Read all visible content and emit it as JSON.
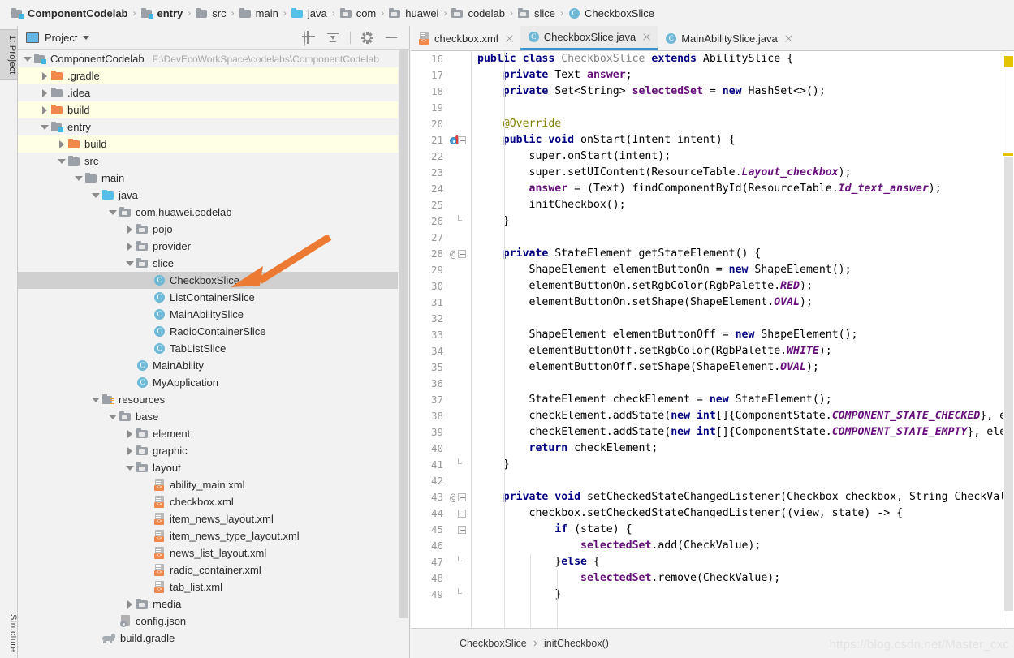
{
  "breadcrumb": {
    "items": [
      {
        "label": "ComponentCodelab",
        "icon": "module-icon",
        "bold": true
      },
      {
        "label": "entry",
        "icon": "module-icon",
        "bold": true
      },
      {
        "label": "src",
        "icon": "folder-icon",
        "bold": false
      },
      {
        "label": "main",
        "icon": "folder-icon",
        "bold": false
      },
      {
        "label": "java",
        "icon": "folder-blue-icon",
        "bold": false
      },
      {
        "label": "com",
        "icon": "package-icon",
        "bold": false
      },
      {
        "label": "huawei",
        "icon": "package-icon",
        "bold": false
      },
      {
        "label": "codelab",
        "icon": "package-icon",
        "bold": false
      },
      {
        "label": "slice",
        "icon": "package-icon",
        "bold": false
      },
      {
        "label": "CheckboxSlice",
        "icon": "class-icon",
        "bold": false
      }
    ],
    "separator": "›"
  },
  "left_strip": {
    "project_tab": "1: Project",
    "structure_tab": "Structure"
  },
  "project_panel": {
    "title": "Project",
    "dropdown_icon": "chevron-down-icon",
    "actions": [
      {
        "name": "locate-icon",
        "tooltip": "Select Opened File"
      },
      {
        "name": "collapse-all-icon",
        "tooltip": "Collapse All"
      },
      {
        "name": "gear-icon",
        "tooltip": "Settings"
      },
      {
        "name": "minimize-icon",
        "tooltip": "Hide"
      }
    ],
    "tree": [
      {
        "label": "ComponentCodelab",
        "path": "F:\\DevEcoWorkSpace\\codelabs\\ComponentCodelab",
        "depth": 0,
        "twist": "open",
        "icon": "module-icon",
        "style": "normal"
      },
      {
        "label": ".gradle",
        "depth": 1,
        "twist": "closed",
        "icon": "folder-orange-icon",
        "style": "ignored"
      },
      {
        "label": ".idea",
        "depth": 1,
        "twist": "closed",
        "icon": "folder-icon",
        "style": "alt"
      },
      {
        "label": "build",
        "depth": 1,
        "twist": "closed",
        "icon": "folder-orange-icon",
        "style": "ignored"
      },
      {
        "label": "entry",
        "depth": 1,
        "twist": "open",
        "icon": "module-icon",
        "style": "alt"
      },
      {
        "label": "build",
        "depth": 2,
        "twist": "closed",
        "icon": "folder-orange-icon",
        "style": "ignored"
      },
      {
        "label": "src",
        "depth": 2,
        "twist": "open",
        "icon": "folder-icon",
        "style": "alt"
      },
      {
        "label": "main",
        "depth": 3,
        "twist": "open",
        "icon": "folder-icon",
        "style": "normal"
      },
      {
        "label": "java",
        "depth": 4,
        "twist": "open",
        "icon": "folder-blue-icon",
        "style": "alt"
      },
      {
        "label": "com.huawei.codelab",
        "depth": 5,
        "twist": "open",
        "icon": "package-icon",
        "style": "normal"
      },
      {
        "label": "pojo",
        "depth": 6,
        "twist": "closed",
        "icon": "package-icon",
        "style": "alt"
      },
      {
        "label": "provider",
        "depth": 6,
        "twist": "closed",
        "icon": "package-icon",
        "style": "normal"
      },
      {
        "label": "slice",
        "depth": 6,
        "twist": "open",
        "icon": "package-icon",
        "style": "alt"
      },
      {
        "label": "CheckboxSlice",
        "depth": 7,
        "twist": "none",
        "icon": "class-icon",
        "style": "selected"
      },
      {
        "label": "ListContainerSlice",
        "depth": 7,
        "twist": "none",
        "icon": "class-icon",
        "style": "alt"
      },
      {
        "label": "MainAbilitySlice",
        "depth": 7,
        "twist": "none",
        "icon": "class-icon",
        "style": "normal"
      },
      {
        "label": "RadioContainerSlice",
        "depth": 7,
        "twist": "none",
        "icon": "class-icon",
        "style": "alt"
      },
      {
        "label": "TabListSlice",
        "depth": 7,
        "twist": "none",
        "icon": "class-icon",
        "style": "normal"
      },
      {
        "label": "MainAbility",
        "depth": 6,
        "twist": "none",
        "icon": "class-icon",
        "style": "alt"
      },
      {
        "label": "MyApplication",
        "depth": 6,
        "twist": "none",
        "icon": "class-icon",
        "style": "normal"
      },
      {
        "label": "resources",
        "depth": 4,
        "twist": "open",
        "icon": "resources-icon",
        "style": "alt"
      },
      {
        "label": "base",
        "depth": 5,
        "twist": "open",
        "icon": "package-icon",
        "style": "normal"
      },
      {
        "label": "element",
        "depth": 6,
        "twist": "closed",
        "icon": "package-icon",
        "style": "alt"
      },
      {
        "label": "graphic",
        "depth": 6,
        "twist": "closed",
        "icon": "package-icon",
        "style": "normal"
      },
      {
        "label": "layout",
        "depth": 6,
        "twist": "open",
        "icon": "package-icon",
        "style": "alt"
      },
      {
        "label": "ability_main.xml",
        "depth": 7,
        "twist": "none",
        "icon": "xml-icon",
        "style": "normal"
      },
      {
        "label": "checkbox.xml",
        "depth": 7,
        "twist": "none",
        "icon": "xml-icon",
        "style": "alt"
      },
      {
        "label": "item_news_layout.xml",
        "depth": 7,
        "twist": "none",
        "icon": "xml-icon",
        "style": "normal"
      },
      {
        "label": "item_news_type_layout.xml",
        "depth": 7,
        "twist": "none",
        "icon": "xml-icon",
        "style": "alt"
      },
      {
        "label": "news_list_layout.xml",
        "depth": 7,
        "twist": "none",
        "icon": "xml-icon",
        "style": "normal"
      },
      {
        "label": "radio_container.xml",
        "depth": 7,
        "twist": "none",
        "icon": "xml-icon",
        "style": "alt"
      },
      {
        "label": "tab_list.xml",
        "depth": 7,
        "twist": "none",
        "icon": "xml-icon",
        "style": "normal"
      },
      {
        "label": "media",
        "depth": 6,
        "twist": "closed",
        "icon": "package-icon",
        "style": "alt"
      },
      {
        "label": "config.json",
        "depth": 5,
        "twist": "none",
        "icon": "json-icon",
        "style": "normal"
      },
      {
        "label": "build.gradle",
        "depth": 4,
        "twist": "none",
        "icon": "gradle-icon",
        "style": "alt"
      }
    ]
  },
  "editor": {
    "tabs": [
      {
        "label": "checkbox.xml",
        "icon": "xml-icon",
        "active": false,
        "close": "close-icon"
      },
      {
        "label": "CheckboxSlice.java",
        "icon": "class-icon",
        "active": true,
        "close": "close-icon"
      },
      {
        "label": "MainAbilitySlice.java",
        "icon": "class-icon",
        "active": false,
        "close": "close-icon"
      }
    ],
    "first_line_number": 16,
    "lines": [
      {
        "n": 16,
        "gutter": "",
        "fold": "none",
        "tokens": [
          {
            "t": "public ",
            "c": "kw"
          },
          {
            "t": "class ",
            "c": "kw"
          },
          {
            "t": "CheckboxSlice ",
            "c": "cls"
          },
          {
            "t": "extends ",
            "c": "kw"
          },
          {
            "t": "AbilitySlice {",
            "c": "pln"
          }
        ]
      },
      {
        "n": 17,
        "gutter": "",
        "fold": "none",
        "tokens": [
          {
            "t": "    ",
            "c": "pln"
          },
          {
            "t": "private ",
            "c": "kw"
          },
          {
            "t": "Text ",
            "c": "pln"
          },
          {
            "t": "answer",
            "c": "fld"
          },
          {
            "t": ";",
            "c": "pln"
          }
        ]
      },
      {
        "n": 18,
        "gutter": "",
        "fold": "none",
        "tokens": [
          {
            "t": "    ",
            "c": "pln"
          },
          {
            "t": "private ",
            "c": "kw"
          },
          {
            "t": "Set<String> ",
            "c": "pln"
          },
          {
            "t": "selectedSet",
            "c": "fld"
          },
          {
            "t": " = ",
            "c": "pln"
          },
          {
            "t": "new ",
            "c": "kw"
          },
          {
            "t": "HashSet<>();",
            "c": "pln"
          }
        ]
      },
      {
        "n": 19,
        "gutter": "",
        "fold": "none",
        "tokens": []
      },
      {
        "n": 20,
        "gutter": "",
        "fold": "none",
        "tokens": [
          {
            "t": "    ",
            "c": "pln"
          },
          {
            "t": "@Override",
            "c": "ann"
          }
        ]
      },
      {
        "n": 21,
        "gutter": "override",
        "fold": "minus",
        "tokens": [
          {
            "t": "    ",
            "c": "pln"
          },
          {
            "t": "public ",
            "c": "kw"
          },
          {
            "t": "void ",
            "c": "kw"
          },
          {
            "t": "onStart(Intent intent) {",
            "c": "pln"
          }
        ]
      },
      {
        "n": 22,
        "gutter": "",
        "fold": "none",
        "tokens": [
          {
            "t": "        super.onStart(intent);",
            "c": "pln"
          }
        ]
      },
      {
        "n": 23,
        "gutter": "",
        "fold": "none",
        "tokens": [
          {
            "t": "        super.setUIContent(ResourceTable.",
            "c": "pln"
          },
          {
            "t": "Layout_checkbox",
            "c": "stat"
          },
          {
            "t": ");",
            "c": "pln"
          }
        ]
      },
      {
        "n": 24,
        "gutter": "",
        "fold": "none",
        "tokens": [
          {
            "t": "        ",
            "c": "pln"
          },
          {
            "t": "answer",
            "c": "fld"
          },
          {
            "t": " = (Text) findComponentById(ResourceTable.",
            "c": "pln"
          },
          {
            "t": "Id_text_answer",
            "c": "stat"
          },
          {
            "t": ");",
            "c": "pln"
          }
        ]
      },
      {
        "n": 25,
        "gutter": "",
        "fold": "none",
        "tokens": [
          {
            "t": "        initCheckbox();",
            "c": "pln"
          }
        ]
      },
      {
        "n": 26,
        "gutter": "",
        "fold": "endbr",
        "tokens": [
          {
            "t": "    }",
            "c": "pln"
          }
        ]
      },
      {
        "n": 27,
        "gutter": "",
        "fold": "none",
        "tokens": []
      },
      {
        "n": 28,
        "gutter": "@",
        "fold": "minus",
        "tokens": [
          {
            "t": "    ",
            "c": "pln"
          },
          {
            "t": "private ",
            "c": "kw"
          },
          {
            "t": "StateElement getStateElement() {",
            "c": "pln"
          }
        ]
      },
      {
        "n": 29,
        "gutter": "",
        "fold": "none",
        "tokens": [
          {
            "t": "        ShapeElement elementButtonOn = ",
            "c": "pln"
          },
          {
            "t": "new ",
            "c": "kw"
          },
          {
            "t": "ShapeElement();",
            "c": "pln"
          }
        ]
      },
      {
        "n": 30,
        "gutter": "",
        "fold": "none",
        "tokens": [
          {
            "t": "        elementButtonOn.setRgbColor(RgbPalette.",
            "c": "pln"
          },
          {
            "t": "RED",
            "c": "stat"
          },
          {
            "t": ");",
            "c": "pln"
          }
        ]
      },
      {
        "n": 31,
        "gutter": "",
        "fold": "none",
        "tokens": [
          {
            "t": "        elementButtonOn.setShape(ShapeElement.",
            "c": "pln"
          },
          {
            "t": "OVAL",
            "c": "stat"
          },
          {
            "t": ");",
            "c": "pln"
          }
        ]
      },
      {
        "n": 32,
        "gutter": "",
        "fold": "none",
        "tokens": []
      },
      {
        "n": 33,
        "gutter": "",
        "fold": "none",
        "tokens": [
          {
            "t": "        ShapeElement elementButtonOff = ",
            "c": "pln"
          },
          {
            "t": "new ",
            "c": "kw"
          },
          {
            "t": "ShapeElement();",
            "c": "pln"
          }
        ]
      },
      {
        "n": 34,
        "gutter": "",
        "fold": "none",
        "tokens": [
          {
            "t": "        elementButtonOff.setRgbColor(RgbPalette.",
            "c": "pln"
          },
          {
            "t": "WHITE",
            "c": "stat"
          },
          {
            "t": ");",
            "c": "pln"
          }
        ]
      },
      {
        "n": 35,
        "gutter": "",
        "fold": "none",
        "tokens": [
          {
            "t": "        elementButtonOff.setShape(ShapeElement.",
            "c": "pln"
          },
          {
            "t": "OVAL",
            "c": "stat"
          },
          {
            "t": ");",
            "c": "pln"
          }
        ]
      },
      {
        "n": 36,
        "gutter": "",
        "fold": "none",
        "tokens": []
      },
      {
        "n": 37,
        "gutter": "",
        "fold": "none",
        "tokens": [
          {
            "t": "        StateElement checkElement = ",
            "c": "pln"
          },
          {
            "t": "new ",
            "c": "kw"
          },
          {
            "t": "StateElement();",
            "c": "pln"
          }
        ]
      },
      {
        "n": 38,
        "gutter": "",
        "fold": "none",
        "tokens": [
          {
            "t": "        checkElement.addState(",
            "c": "pln"
          },
          {
            "t": "new ",
            "c": "kw"
          },
          {
            "t": "int",
            "c": "kw"
          },
          {
            "t": "[]{ComponentState.",
            "c": "pln"
          },
          {
            "t": "COMPONENT_STATE_CHECKED",
            "c": "stat"
          },
          {
            "t": "}, elementButtonOn)",
            "c": "pln"
          }
        ]
      },
      {
        "n": 39,
        "gutter": "",
        "fold": "none",
        "tokens": [
          {
            "t": "        checkElement.addState(",
            "c": "pln"
          },
          {
            "t": "new ",
            "c": "kw"
          },
          {
            "t": "int",
            "c": "kw"
          },
          {
            "t": "[]{ComponentState.",
            "c": "pln"
          },
          {
            "t": "COMPONENT_STATE_EMPTY",
            "c": "stat"
          },
          {
            "t": "}, elementButtonOff);",
            "c": "pln"
          }
        ]
      },
      {
        "n": 40,
        "gutter": "",
        "fold": "none",
        "tokens": [
          {
            "t": "        ",
            "c": "pln"
          },
          {
            "t": "return ",
            "c": "kw"
          },
          {
            "t": "checkElement;",
            "c": "pln"
          }
        ]
      },
      {
        "n": 41,
        "gutter": "",
        "fold": "endbr",
        "tokens": [
          {
            "t": "    }",
            "c": "pln"
          }
        ]
      },
      {
        "n": 42,
        "gutter": "",
        "fold": "none",
        "tokens": []
      },
      {
        "n": 43,
        "gutter": "@",
        "fold": "minus",
        "tokens": [
          {
            "t": "    ",
            "c": "pln"
          },
          {
            "t": "private ",
            "c": "kw"
          },
          {
            "t": "void ",
            "c": "kw"
          },
          {
            "t": "setCheckedStateChangedListener(Checkbox checkbox, String CheckValue) {",
            "c": "pln"
          }
        ]
      },
      {
        "n": 44,
        "gutter": "",
        "fold": "minus",
        "tokens": [
          {
            "t": "        checkbox.setCheckedStateChangedListener((view, state) -> {",
            "c": "pln"
          }
        ]
      },
      {
        "n": 45,
        "gutter": "",
        "fold": "minus",
        "tokens": [
          {
            "t": "            ",
            "c": "pln"
          },
          {
            "t": "if ",
            "c": "kw"
          },
          {
            "t": "(state) {",
            "c": "pln"
          }
        ]
      },
      {
        "n": 46,
        "gutter": "",
        "fold": "none",
        "tokens": [
          {
            "t": "                ",
            "c": "pln"
          },
          {
            "t": "selectedSet",
            "c": "fld"
          },
          {
            "t": ".add(CheckValue);",
            "c": "pln"
          }
        ]
      },
      {
        "n": 47,
        "gutter": "",
        "fold": "endbr",
        "tokens": [
          {
            "t": "            }",
            "c": "pln"
          },
          {
            "t": "else ",
            "c": "kw"
          },
          {
            "t": "{",
            "c": "pln"
          }
        ]
      },
      {
        "n": 48,
        "gutter": "",
        "fold": "none",
        "tokens": [
          {
            "t": "                ",
            "c": "pln"
          },
          {
            "t": "selectedSet",
            "c": "fld"
          },
          {
            "t": ".remove(CheckValue);",
            "c": "pln"
          }
        ]
      },
      {
        "n": 49,
        "gutter": "",
        "fold": "endbr",
        "tokens": [
          {
            "t": "            }",
            "c": "pln"
          }
        ]
      }
    ]
  },
  "status": {
    "breadcrumb": [
      "CheckboxSlice",
      "initCheckbox()"
    ],
    "separator": "›",
    "watermark": "https://blog.csdn.net/Master_cxc"
  },
  "annotation": {
    "arrow_color": "#ec7a32",
    "points_to": "CheckboxSlice"
  },
  "colors": {
    "accent": "#3b95d4",
    "selection": "#d0d0d0",
    "ignored_row": "#ffffe4",
    "warning_marker": "#e2c500",
    "keyword": "#000080",
    "field": "#660e7a",
    "annotation": "#808000"
  }
}
